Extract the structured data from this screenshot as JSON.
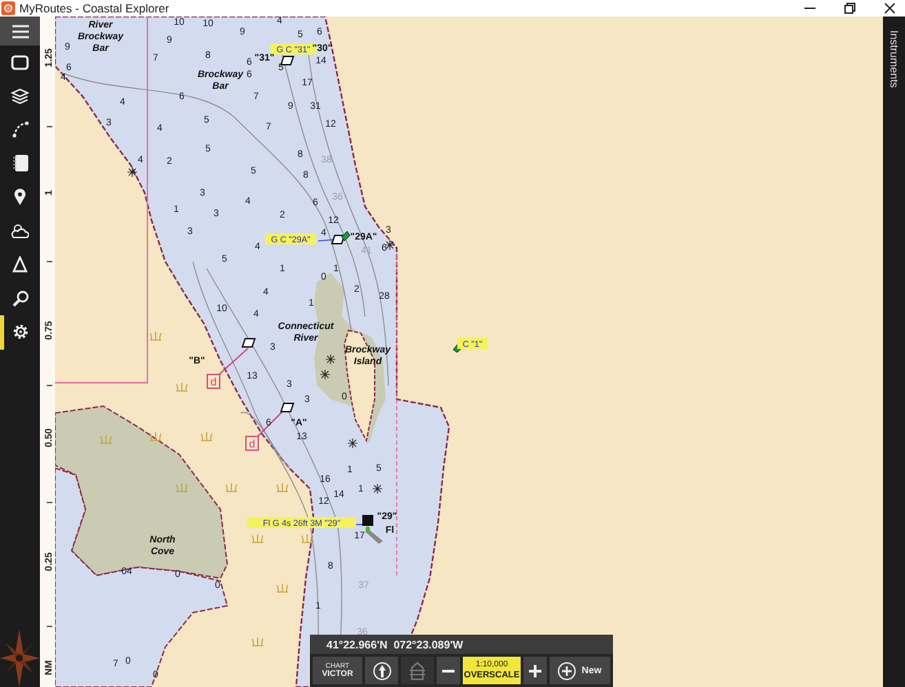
{
  "window": {
    "title": "MyRoutes - Coastal Explorer"
  },
  "sidebar": {
    "items": [
      {
        "kind": "chart-view",
        "selected": false
      },
      {
        "kind": "layers",
        "selected": false
      },
      {
        "kind": "route",
        "selected": false
      },
      {
        "kind": "notebook",
        "selected": false
      },
      {
        "kind": "pin",
        "selected": false
      },
      {
        "kind": "weather",
        "selected": false
      },
      {
        "kind": "triangle",
        "selected": false
      },
      {
        "kind": "search",
        "selected": false
      },
      {
        "kind": "settings",
        "selected": true
      }
    ]
  },
  "scale_ruler": [
    "1.25",
    "1",
    "0.75",
    "0.50",
    "0.25",
    "NM"
  ],
  "soundings": [
    {
      "depth": "10",
      "kind": "normal"
    },
    {
      "depth": "10",
      "kind": "normal"
    },
    {
      "depth": "9",
      "kind": "normal"
    },
    {
      "depth": "4",
      "kind": "normal"
    },
    {
      "depth": "5",
      "kind": "normal"
    },
    {
      "depth": "6",
      "kind": "normal"
    },
    {
      "depth": "9",
      "kind": "normal"
    },
    {
      "depth": "9",
      "kind": "normal"
    },
    {
      "depth": "7",
      "kind": "normal"
    },
    {
      "depth": "8",
      "kind": "normal"
    },
    {
      "depth": "6",
      "kind": "normal"
    },
    {
      "depth": "5",
      "kind": "normal"
    },
    {
      "depth": "14",
      "kind": "normal"
    },
    {
      "depth": "6",
      "kind": "normal"
    },
    {
      "depth": "6",
      "kind": "normal"
    },
    {
      "depth": "4",
      "kind": "normal"
    },
    {
      "depth": "17",
      "kind": "normal"
    },
    {
      "depth": "7",
      "kind": "normal"
    },
    {
      "depth": "6",
      "kind": "normal"
    },
    {
      "depth": "9",
      "kind": "normal"
    },
    {
      "depth": "31",
      "kind": "normal"
    },
    {
      "depth": "4",
      "kind": "normal"
    },
    {
      "depth": "3",
      "kind": "normal"
    },
    {
      "depth": "4",
      "kind": "normal"
    },
    {
      "depth": "5",
      "kind": "normal"
    },
    {
      "depth": "7",
      "kind": "normal"
    },
    {
      "depth": "12",
      "kind": "normal"
    },
    {
      "depth": "5",
      "kind": "normal"
    },
    {
      "depth": "8",
      "kind": "normal"
    },
    {
      "depth": "4",
      "kind": "normal"
    },
    {
      "depth": "2",
      "kind": "normal"
    },
    {
      "depth": "38",
      "kind": "faint"
    },
    {
      "depth": "5",
      "kind": "normal"
    },
    {
      "depth": "8",
      "kind": "normal"
    },
    {
      "depth": "3",
      "kind": "normal"
    },
    {
      "depth": "4",
      "kind": "normal"
    },
    {
      "depth": "6",
      "kind": "normal"
    },
    {
      "depth": "36",
      "kind": "faint"
    },
    {
      "depth": "1",
      "kind": "normal"
    },
    {
      "depth": "3",
      "kind": "normal"
    },
    {
      "depth": "2",
      "kind": "normal"
    },
    {
      "depth": "12",
      "kind": "normal"
    },
    {
      "depth": "3",
      "kind": "normal"
    },
    {
      "depth": "4",
      "kind": "normal"
    },
    {
      "depth": "5",
      "kind": "normal"
    },
    {
      "depth": "4",
      "kind": "normal"
    },
    {
      "depth": "1",
      "kind": "normal"
    },
    {
      "depth": "1",
      "kind": "normal"
    },
    {
      "depth": "6",
      "kind": "normal"
    },
    {
      "depth": "3",
      "kind": "normal"
    },
    {
      "depth": "41",
      "kind": "faint"
    },
    {
      "depth": "0",
      "kind": "normal"
    },
    {
      "depth": "4",
      "kind": "normal"
    },
    {
      "depth": "2",
      "kind": "normal"
    },
    {
      "depth": "28",
      "kind": "normal"
    },
    {
      "depth": "10",
      "kind": "normal"
    },
    {
      "depth": "1",
      "kind": "normal"
    },
    {
      "depth": "4",
      "kind": "normal"
    },
    {
      "depth": "3",
      "kind": "normal"
    },
    {
      "depth": "13",
      "kind": "normal"
    },
    {
      "depth": "3",
      "kind": "normal"
    },
    {
      "depth": "3",
      "kind": "normal"
    },
    {
      "depth": "6",
      "kind": "normal"
    },
    {
      "depth": "13",
      "kind": "normal"
    },
    {
      "depth": "0",
      "kind": "normal"
    },
    {
      "depth": "1",
      "kind": "normal"
    },
    {
      "depth": "5",
      "kind": "normal"
    },
    {
      "depth": "16",
      "kind": "normal"
    },
    {
      "depth": "14",
      "kind": "normal"
    },
    {
      "depth": "1",
      "kind": "normal"
    },
    {
      "depth": "12",
      "kind": "normal"
    },
    {
      "depth": "17",
      "kind": "normal"
    },
    {
      "depth": "8",
      "kind": "normal"
    },
    {
      "depth": "37",
      "kind": "faint"
    },
    {
      "depth": "1",
      "kind": "normal"
    },
    {
      "depth": "36",
      "kind": "faint"
    },
    {
      "depth": "0",
      "kind": "normal"
    },
    {
      "depth": "0",
      "kind": "normal"
    },
    {
      "depth": "04",
      "kind": "normal"
    },
    {
      "depth": "0",
      "kind": "normal"
    },
    {
      "depth": "7",
      "kind": "normal"
    },
    {
      "depth": "0",
      "kind": "normal"
    }
  ],
  "chart_labels": [
    {
      "kind": "name",
      "lines": [
        "River",
        "Brockway",
        "Bar"
      ]
    },
    {
      "kind": "tag",
      "text": "G C \"31\""
    },
    {
      "kind": "designation",
      "text": "\"30\""
    },
    {
      "kind": "designation",
      "text": "\"31\""
    },
    {
      "kind": "name",
      "lines": [
        "Brockway",
        "Bar"
      ]
    },
    {
      "kind": "tag",
      "text": "G C \"29A\""
    },
    {
      "kind": "designation",
      "text": "\"29A\""
    },
    {
      "kind": "tag",
      "text": "C \"1\""
    },
    {
      "kind": "name",
      "lines": [
        "Connecticut",
        "River"
      ]
    },
    {
      "kind": "designation",
      "text": "\"B\""
    },
    {
      "kind": "name",
      "lines": [
        "Brockway",
        "Island"
      ]
    },
    {
      "kind": "range",
      "text": "d"
    },
    {
      "kind": "designation",
      "text": "\"A\""
    },
    {
      "kind": "range",
      "text": "d"
    },
    {
      "kind": "tag",
      "text": "Fl G 4s 26ft 3M \"29\""
    },
    {
      "kind": "designation",
      "text": "\"29\""
    },
    {
      "kind": "designation",
      "text": "Fl"
    },
    {
      "kind": "name",
      "lines": [
        "North",
        "Cove"
      ]
    }
  ],
  "toolbar": {
    "coordinates": "41°22.966'N  072°23.089'W",
    "buttons": [
      {
        "kind": "chart",
        "label": "CHART",
        "value": "VICTOR",
        "disabled": false
      },
      {
        "kind": "north-up",
        "disabled": false
      },
      {
        "kind": "boat",
        "disabled": true
      },
      {
        "kind": "zoom-out",
        "disabled": false
      },
      {
        "kind": "scale",
        "label": "1:10,000",
        "value": "OVERSCALE",
        "disabled": false
      },
      {
        "kind": "zoom-in",
        "disabled": false
      },
      {
        "kind": "new",
        "label": "New",
        "disabled": false
      }
    ]
  },
  "right_panel": {
    "title": "Instruments"
  }
}
